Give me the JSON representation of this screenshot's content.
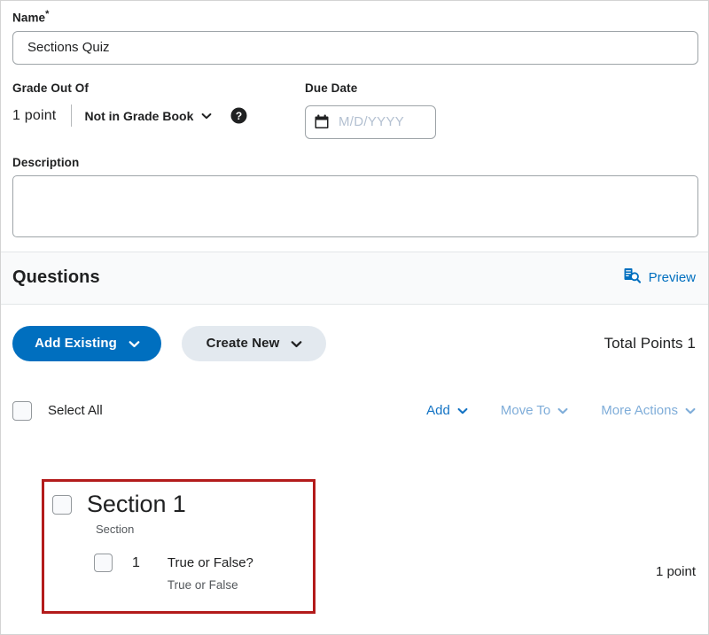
{
  "form": {
    "name": {
      "label": "Name",
      "required_marker": "*",
      "value": "Sections Quiz",
      "placeholder": ""
    },
    "grade_out_of": {
      "label": "Grade Out Of",
      "points_value": "1 point",
      "grade_book_option": "Not in Grade Book",
      "help_icon": "help-circle-icon",
      "chevron_icon": "chevron-down-icon"
    },
    "due_date": {
      "label": "Due Date",
      "value": "",
      "placeholder": "M/D/YYYY",
      "calendar_icon": "calendar-icon"
    },
    "description": {
      "label": "Description",
      "value": "",
      "placeholder": ""
    }
  },
  "questions_panel": {
    "title": "Questions",
    "preview": {
      "label": "Preview",
      "icon": "document-search-icon"
    },
    "buttons": {
      "add_existing": "Add Existing",
      "create_new": "Create New"
    },
    "total_points": "Total Points 1",
    "select_all_label": "Select All",
    "bulk_actions": [
      {
        "label": "Add",
        "disabled": false
      },
      {
        "label": "Move To",
        "disabled": true
      },
      {
        "label": "More Actions",
        "disabled": true
      }
    ],
    "section": {
      "title": "Section 1",
      "subtitle": "Section",
      "questions": [
        {
          "number": "1",
          "text": "True or False?",
          "type": "True or False",
          "points": "1 point"
        }
      ]
    }
  },
  "colors": {
    "primary_blue": "#006fbf",
    "link_blue": "#1373c4",
    "disabled_link_blue": "#7fadd9",
    "highlight_red": "#b31b1b",
    "band_background": "#f9fafb",
    "secondary_button": "#e3e9ef"
  }
}
